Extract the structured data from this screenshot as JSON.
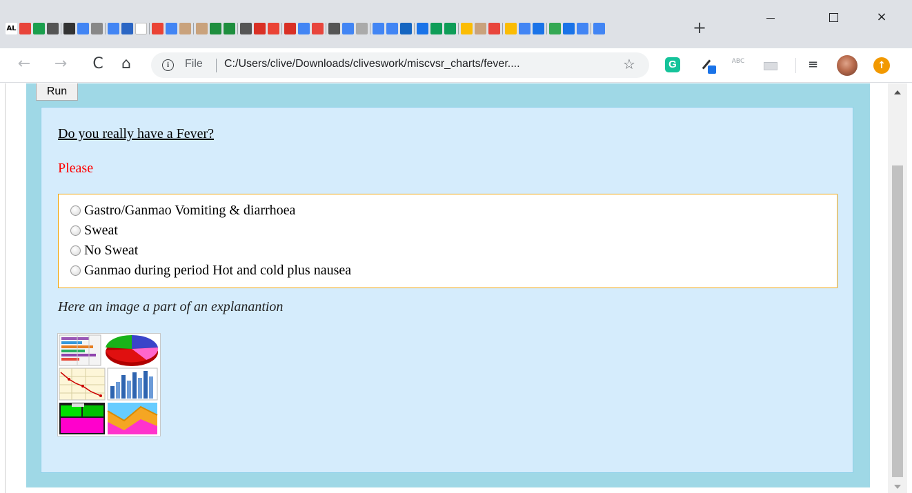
{
  "window": {
    "new_tab_label": "+",
    "minimize_label": "",
    "maximize_label": "",
    "close_label": "×",
    "favicon_text": "AL"
  },
  "favicons": [
    "#e8443a",
    "#1a9f4d",
    "#555555",
    "#333333",
    "#4285f4",
    "#888888",
    "#4285f4",
    "#2b66c4",
    "#ffffff",
    "#ea4335",
    "#4285f4",
    "#c9a27c",
    "#c9a27c",
    "#1e8e3e",
    "#1e8e3e",
    "#555555",
    "#d93025",
    "#ea4335",
    "#d93025",
    "#4285f4",
    "#e8453c",
    "#555555",
    "#4285f4",
    "#aaaaaa",
    "#4285f4",
    "#4285f4",
    "#1565c0",
    "#1a73e8",
    "#0f9d58",
    "#0f9d58",
    "#fbbc04",
    "#c9a27c",
    "#e8453c",
    "#fbbc04",
    "#4285f4",
    "#1a73e8",
    "#34a853",
    "#1a73e8",
    "#4285f4",
    "#4285f4"
  ],
  "nav": {
    "back_icon": "←",
    "forward_icon": "→",
    "reload_icon": "C",
    "home_icon": "⌂"
  },
  "address_bar": {
    "info_icon": "i",
    "scheme_label": "File",
    "url": "C:/Users/clive/Downloads/cliveswork/miscvsr_charts/fever....",
    "star_icon": "☆"
  },
  "extensions": {
    "grammarly": "G",
    "spellcheck": "ABC",
    "playlist": "≡",
    "update": "↑"
  },
  "page": {
    "run_label": "Run",
    "question_title": "Do you really have a Fever?",
    "please_text": "Please",
    "options": [
      "Gastro/Ganmao Vomiting & diarrhoea",
      "Sweat",
      "No Sweat",
      "Ganmao during period Hot and cold plus nausea"
    ],
    "caption": "Here an image a part of an explanantion"
  },
  "colors": {
    "outer_panel": "#9fd8e6",
    "inner_panel": "#d5ecfc",
    "options_border": "#f0a30a",
    "please_red": "#ff0000"
  }
}
